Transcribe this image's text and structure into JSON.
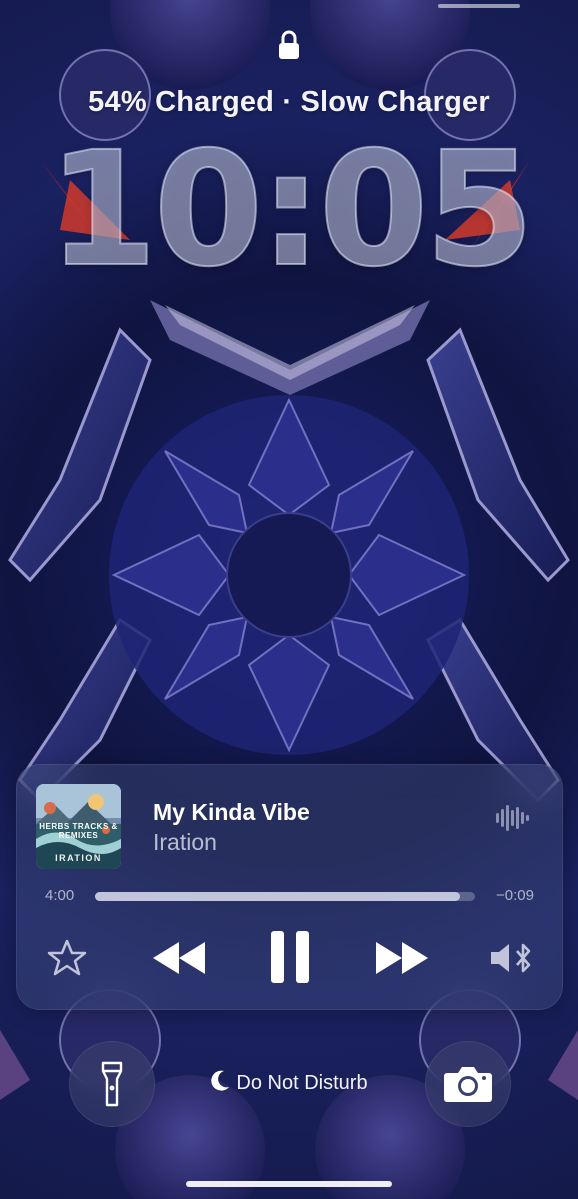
{
  "lock_screen": {
    "charge_status": "54% Charged · Slow Charger",
    "time": "10:05",
    "focus_mode": "Do Not Disturb"
  },
  "now_playing": {
    "artwork": {
      "title_text": "HERBS TRACKS & REMIXES",
      "band_text": "IRATION"
    },
    "song_title": "My Kinda Vibe",
    "artist": "Iration",
    "elapsed": "4:00",
    "remaining": "−0:09",
    "progress_fraction": 0.96
  },
  "icons": {
    "lock": "lock-icon",
    "waveform": "waveform-icon",
    "favorite": "star-icon",
    "rewind": "rewind-icon",
    "pause": "pause-icon",
    "forward": "fast-forward-icon",
    "audio_output": "speaker-bluetooth-icon",
    "flashlight": "flashlight-icon",
    "camera": "camera-icon",
    "moon": "moon-icon"
  },
  "colors": {
    "wallpaper_base": "#1b2257",
    "crystal_accent": "#c0392b",
    "text": "#f2f2f7"
  }
}
